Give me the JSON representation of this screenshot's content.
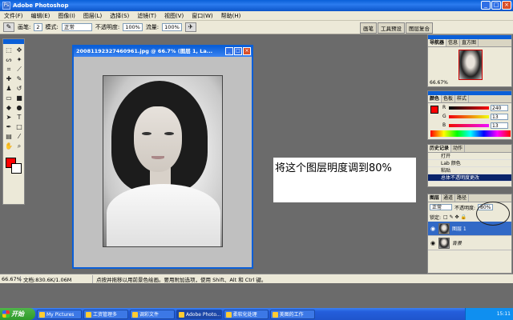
{
  "app": {
    "title": "Adobe Photoshop",
    "logo_text": "Ps"
  },
  "menu": [
    "文件(F)",
    "编辑(E)",
    "图像(I)",
    "图层(L)",
    "选择(S)",
    "滤镜(T)",
    "视图(V)",
    "窗口(W)",
    "帮助(H)"
  ],
  "options": {
    "brush_label": "画笔:",
    "brush_size": "2",
    "mode_label": "模式:",
    "mode_value": "正常",
    "opacity_label": "不透明度:",
    "opacity_value": "100%",
    "flow_label": "流量:",
    "flow_value": "100%"
  },
  "palette_well": [
    "画笔",
    "工具预设",
    "图层复合"
  ],
  "document": {
    "title": "20081192327460961.jpg @ 66.7% (图层 1, La..."
  },
  "annotation": {
    "text": "将这个图层明度调到80%"
  },
  "navigator": {
    "tabs": [
      "导航器",
      "信息",
      "直方图"
    ],
    "zoom": "66.67%"
  },
  "color_panel": {
    "tabs": [
      "颜色",
      "色板",
      "样式"
    ],
    "channels": [
      {
        "name": "R",
        "value": "240"
      },
      {
        "name": "G",
        "value": "13"
      },
      {
        "name": "B",
        "value": "13"
      }
    ]
  },
  "history": {
    "tabs": [
      "历史记录",
      "动作"
    ],
    "items": [
      "打开",
      "Lab 颜色",
      "粘贴",
      "总体不透明度更改"
    ]
  },
  "layers": {
    "tabs": [
      "图层",
      "通道",
      "路径"
    ],
    "blend_mode": "正常",
    "opacity_label": "不透明度:",
    "opacity_value": "80%",
    "lock_label": "锁定:",
    "rows": [
      {
        "name": "图层 1"
      },
      {
        "name": "背景"
      }
    ]
  },
  "status": {
    "zoom": "66.67%",
    "doc_size": "文档:830.6K/1.06M",
    "hint": "点按并拖移以用前景色绘画。要用附加选项，使用 Shift、Alt 和 Ctrl 键。"
  },
  "taskbar": {
    "start": "开始",
    "tasks": [
      "My Pictures",
      "工资管理多",
      "调彩文件",
      "Adobe Photo...",
      "柔软化处理",
      "美图的工作"
    ],
    "clock": "15:11"
  }
}
